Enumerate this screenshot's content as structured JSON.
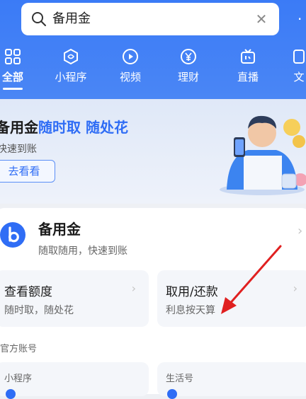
{
  "search": {
    "query": "备用金",
    "clear_icon": "close-icon",
    "search_icon": "search-icon"
  },
  "categories": [
    {
      "label": "全部",
      "icon": "grid-icon",
      "active": true
    },
    {
      "label": "小程序",
      "icon": "mini-program-icon"
    },
    {
      "label": "视频",
      "icon": "play-icon"
    },
    {
      "label": "理财",
      "icon": "yen-icon"
    },
    {
      "label": "直播",
      "icon": "tv-icon"
    },
    {
      "label": "文"
    }
  ],
  "banner": {
    "title_black": "备用金",
    "title_blue": "随时取 随处花",
    "subtitle": "快速到账",
    "cta": "去看看"
  },
  "app": {
    "name": "备用金",
    "desc": "随取随用，快速到账",
    "tiles": [
      {
        "title": "查看额度",
        "sub": "随时取，随处花"
      },
      {
        "title": "取用/还款",
        "sub": "利息按天算"
      }
    ],
    "section_label": "官方账号",
    "sub_tiles": [
      {
        "label": "小程序"
      },
      {
        "label": "生活号"
      }
    ]
  },
  "colors": {
    "accent": "#2f6df5",
    "header_bg": "#3b7bf6",
    "arrow": "#e02020"
  }
}
